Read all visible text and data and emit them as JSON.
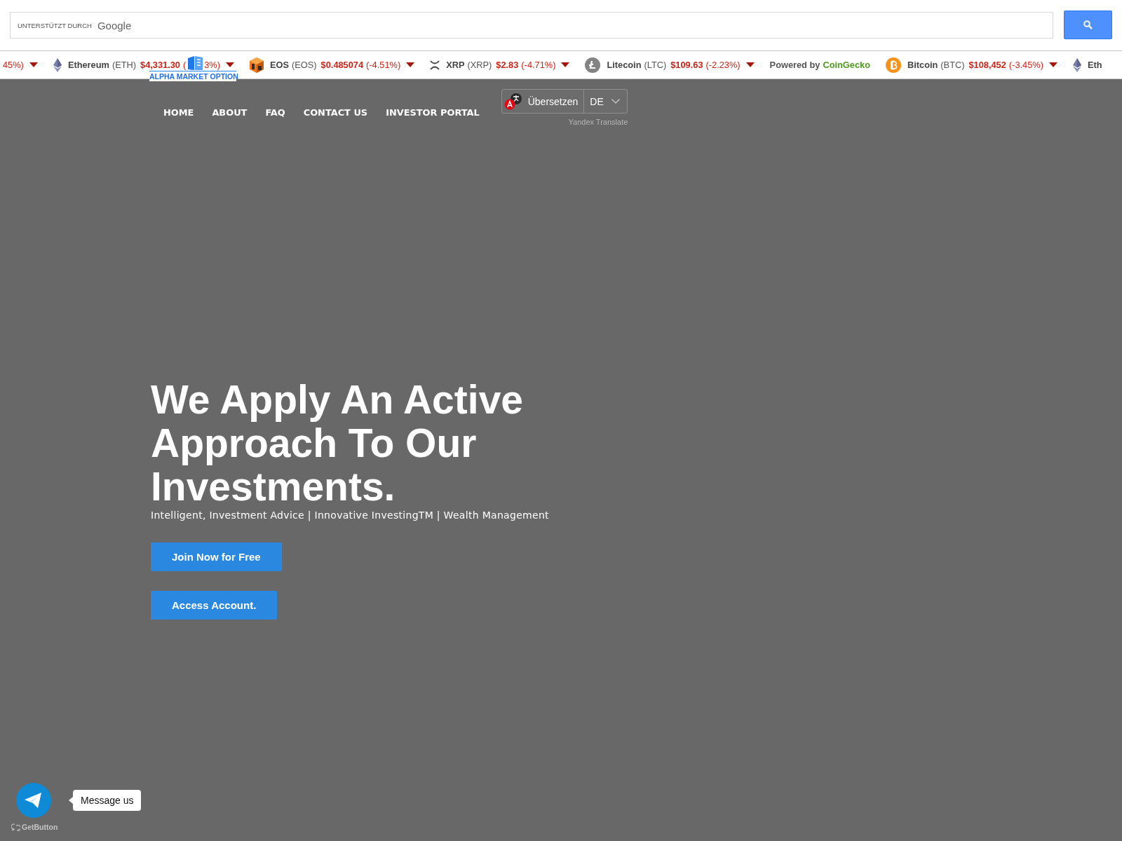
{
  "search": {
    "branding_label": "UNTERSTÜTZT DURCH",
    "branding_brand": "Google"
  },
  "ticker": {
    "items": [
      {
        "kind": "coin",
        "change": "45%)",
        "falling": true
      },
      {
        "kind": "coin",
        "name": "Ethereum",
        "symbol": "(ETH)",
        "price": "$4,331.30",
        "change": "(",
        "change_tail": "3%)",
        "falling": true
      },
      {
        "kind": "coin",
        "name": "EOS",
        "symbol": "(EOS)",
        "price": "$0.485074",
        "change": "(-4.51%)",
        "falling": true
      },
      {
        "kind": "coin",
        "name": "XRP",
        "symbol": "(XRP)",
        "price": "$2.83",
        "change": "(-4.71%)",
        "falling": true
      },
      {
        "kind": "coin",
        "name": "Litecoin",
        "symbol": "(LTC)",
        "price": "$109.63",
        "change": "(-2.23%)",
        "falling": true
      },
      {
        "kind": "attribution",
        "text": "Powered by",
        "link": "CoinGecko"
      },
      {
        "kind": "coin",
        "name": "Bitcoin",
        "symbol": "(BTC)",
        "price": "$108,452",
        "change": "(-3.45%)",
        "falling": true
      },
      {
        "kind": "coin",
        "name": "Eth"
      }
    ]
  },
  "logo": {
    "text": "ALPHA MARKET OPTION"
  },
  "nav": {
    "items": [
      "HOME",
      "ABOUT",
      "FAQ",
      "CONTACT US",
      "INVESTOR PORTAL"
    ]
  },
  "translate": {
    "button": "Übersetzen",
    "language": "DE",
    "credit": "Yandex Translate"
  },
  "hero": {
    "title": "We Apply An Active Approach To Our Investments.",
    "subtitle": "Intelligent, Investment Advice | Innovative InvestingTM | Wealth Management",
    "buttons": [
      "Join Now for Free",
      "Access Account."
    ]
  },
  "chat_widget": {
    "tooltip": "Message us",
    "credit": "GetButton"
  }
}
